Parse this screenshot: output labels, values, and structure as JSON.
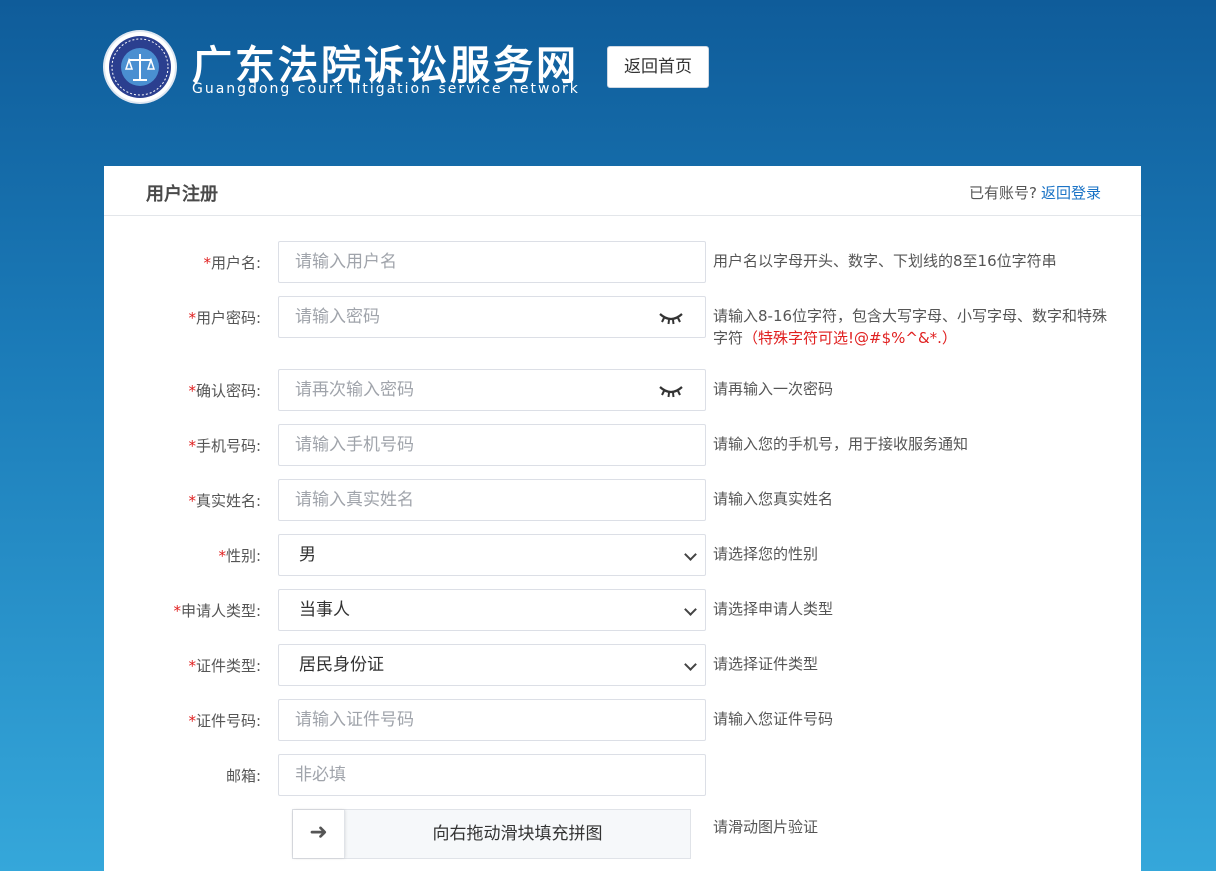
{
  "header": {
    "site_title": "广东法院诉讼服务网",
    "site_subtitle": "Guangdong court litigation service network",
    "home_button": "返回首页",
    "brand_color": "#0f5c9a",
    "seal_text": "广东省高级人民法院 THE HIGHER PEOPLE'S COURT OF GUANGDONG PROVINCE"
  },
  "card": {
    "title": "用户注册",
    "have_account": "已有账号?",
    "back_login": "返回登录"
  },
  "form": {
    "required_mark": "*",
    "username": {
      "label": "用户名:",
      "placeholder": "请输入用户名",
      "hint": "用户名以字母开头、数字、下划线的8至16位字符串"
    },
    "password": {
      "label": "用户密码:",
      "placeholder": "请输入密码",
      "hint": "请输入8-16位字符，包含大写字母、小写字母、数字和特殊",
      "hint_line2": "字符",
      "hint_note": "（特殊字符可选!@#$%^&*.）",
      "toggle_icon": "eye-closed-icon"
    },
    "confirm_password": {
      "label": "确认密码:",
      "placeholder": "请再次输入密码",
      "hint": "请再输入一次密码",
      "toggle_icon": "eye-closed-icon"
    },
    "phone": {
      "label": "手机号码:",
      "placeholder": "请输入手机号码",
      "hint": "请输入您的手机号，用于接收服务通知"
    },
    "real_name": {
      "label": "真实姓名:",
      "placeholder": "请输入真实姓名",
      "hint": "请输入您真实姓名"
    },
    "gender": {
      "label": "性别:",
      "value": "男",
      "hint": "请选择您的性别"
    },
    "applicant_type": {
      "label": "申请人类型:",
      "value": "当事人",
      "hint": "请选择申请人类型"
    },
    "id_type": {
      "label": "证件类型:",
      "value": "居民身份证",
      "hint": "请选择证件类型"
    },
    "id_number": {
      "label": "证件号码:",
      "placeholder": "请输入证件号码",
      "hint": "请输入您证件号码"
    },
    "email": {
      "label": "邮箱:",
      "placeholder": "非必填"
    },
    "captcha": {
      "arrow": "➜",
      "text": "向右拖动滑块填充拼图",
      "hint": "请滑动图片验证"
    }
  }
}
